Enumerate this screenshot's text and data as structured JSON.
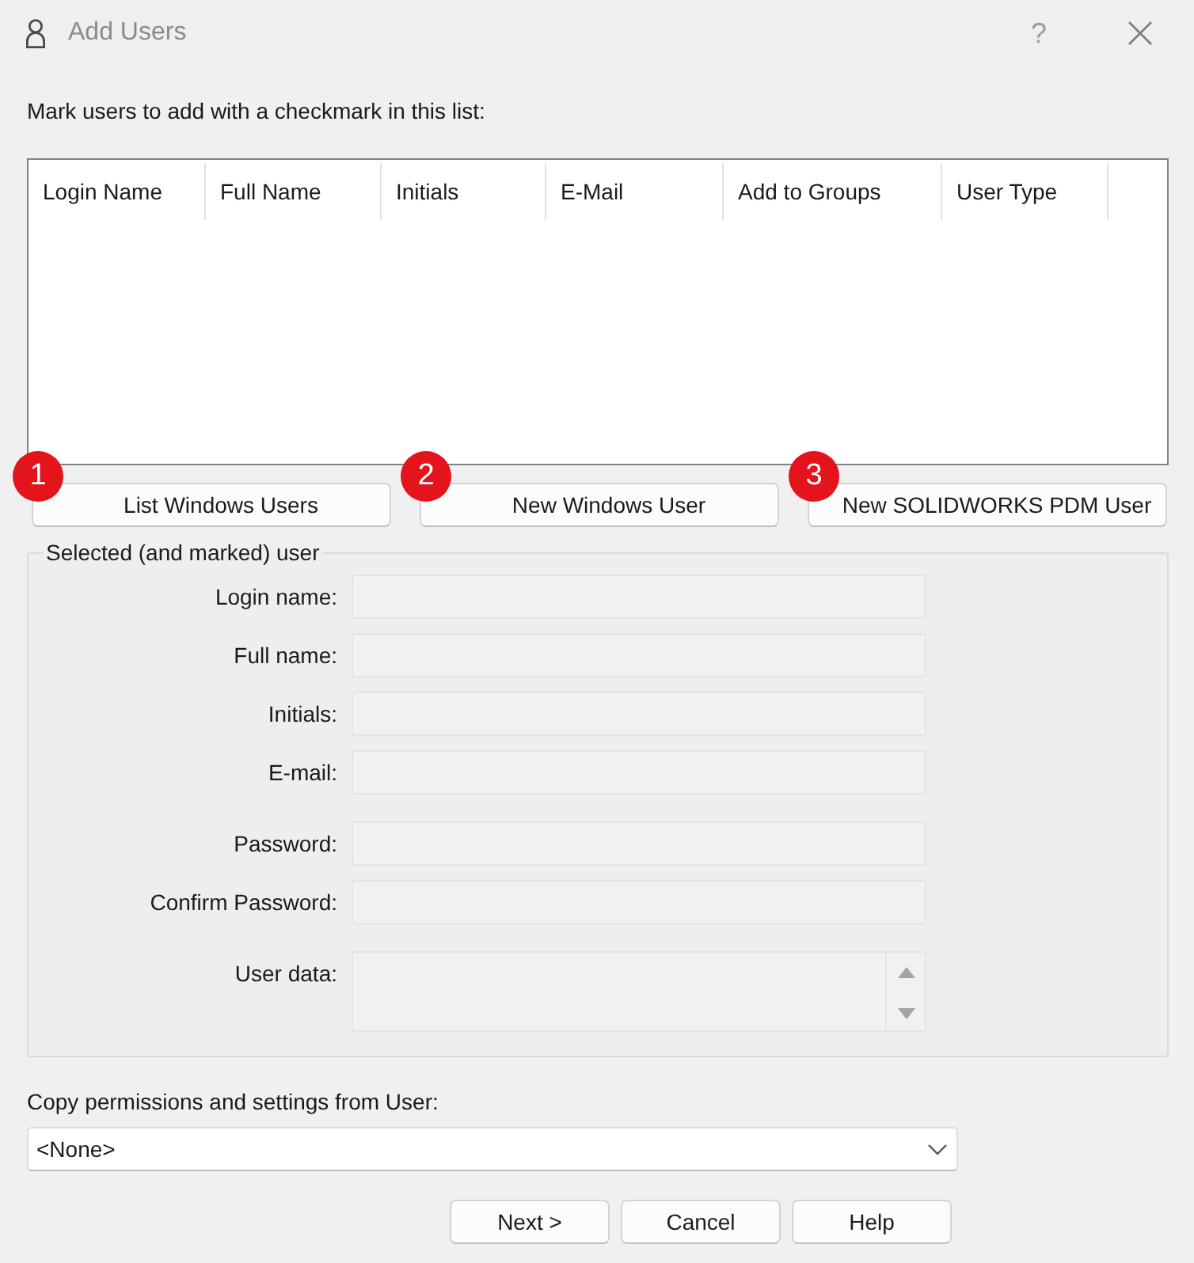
{
  "window": {
    "title": "Add Users",
    "help": "?"
  },
  "instruction": "Mark users to add with a checkmark in this list:",
  "user_list": {
    "columns": [
      "Login Name",
      "Full Name",
      "Initials",
      "E-Mail",
      "Add to Groups",
      "User Type"
    ]
  },
  "list_buttons": [
    {
      "label": "List Windows Users",
      "callout": "1"
    },
    {
      "label": "New Windows User",
      "callout": "2"
    },
    {
      "label": "New SOLIDWORKS PDM User",
      "callout": "3"
    }
  ],
  "selected_user": {
    "title": "Selected (and marked) user",
    "field_groups": [
      [
        {
          "label": "Login name:",
          "kind": "text",
          "disabled": true
        },
        {
          "label": "Full name:",
          "kind": "text",
          "disabled": true
        },
        {
          "label": "Initials:",
          "kind": "text",
          "disabled": true
        },
        {
          "label": "E-mail:",
          "kind": "text",
          "disabled": true
        }
      ],
      [
        {
          "label": "Password:",
          "kind": "text",
          "disabled": true
        },
        {
          "label": "Confirm Password:",
          "kind": "text",
          "disabled": true
        }
      ],
      [
        {
          "label": "User data:",
          "kind": "multiline",
          "disabled": true
        }
      ]
    ]
  },
  "copy_from": {
    "label": "Copy permissions and settings from User:",
    "value": "<None>"
  },
  "buttons": [
    "Next >",
    "Cancel",
    "Help"
  ]
}
